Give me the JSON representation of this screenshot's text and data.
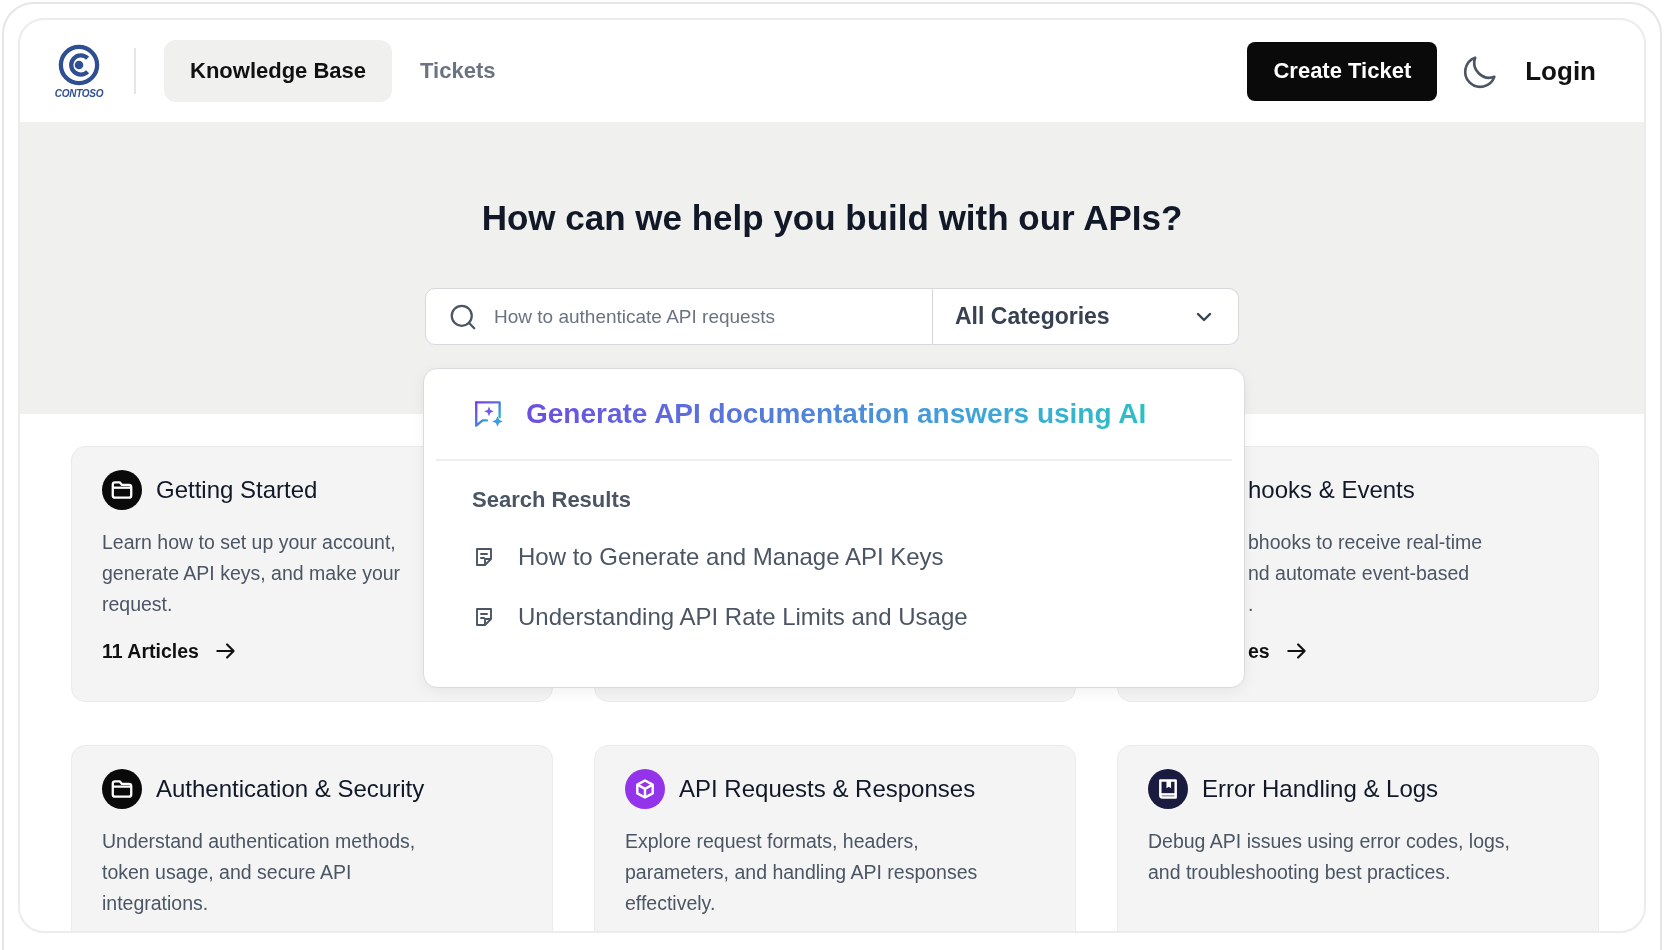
{
  "header": {
    "logo_text": "CONTOSO",
    "nav": [
      {
        "label": "Knowledge Base",
        "selected": true
      },
      {
        "label": "Tickets",
        "selected": false
      }
    ],
    "create_button": "Create Ticket",
    "login": "Login"
  },
  "hero": {
    "title": "How can we help you build with our APIs?",
    "search": {
      "placeholder": "How to authenticate API requests"
    },
    "category_select": "All Categories"
  },
  "dropdown": {
    "ai_suggestion": "Generate API documentation answers using AI",
    "results_heading": "Search Results",
    "results": [
      "How to Generate and Manage API Keys",
      "Understanding API Rate Limits and Usage"
    ]
  },
  "categories": [
    {
      "kind": "folder",
      "color": "#0a0a0a",
      "title": "Getting Started",
      "description": [
        "Learn how to set up your account,",
        "generate API keys, and make your",
        "request."
      ],
      "articles": "11 Articles"
    },
    {
      "kind": "covered"
    },
    {
      "kind": "clipped",
      "title": "hooks & Events",
      "description": [
        "bhooks to receive real-time",
        "nd automate event-based",
        "."
      ],
      "articles": "es"
    },
    {
      "kind": "folder",
      "color": "#0a0a0a",
      "title": "Authentication & Security",
      "description": [
        "Understand authentication methods,",
        "token usage, and secure API",
        "integrations."
      ]
    },
    {
      "kind": "cube",
      "color": "#9333ea",
      "title": "API Requests & Responses",
      "description": [
        "Explore request formats, headers,",
        "parameters, and handling API responses",
        "effectively."
      ]
    },
    {
      "kind": "book",
      "color": "#1b1a3f",
      "title": "Error Handling & Logs",
      "description": [
        "Debug API issues using error codes, logs,",
        "and troubleshooting best practices."
      ]
    }
  ]
}
